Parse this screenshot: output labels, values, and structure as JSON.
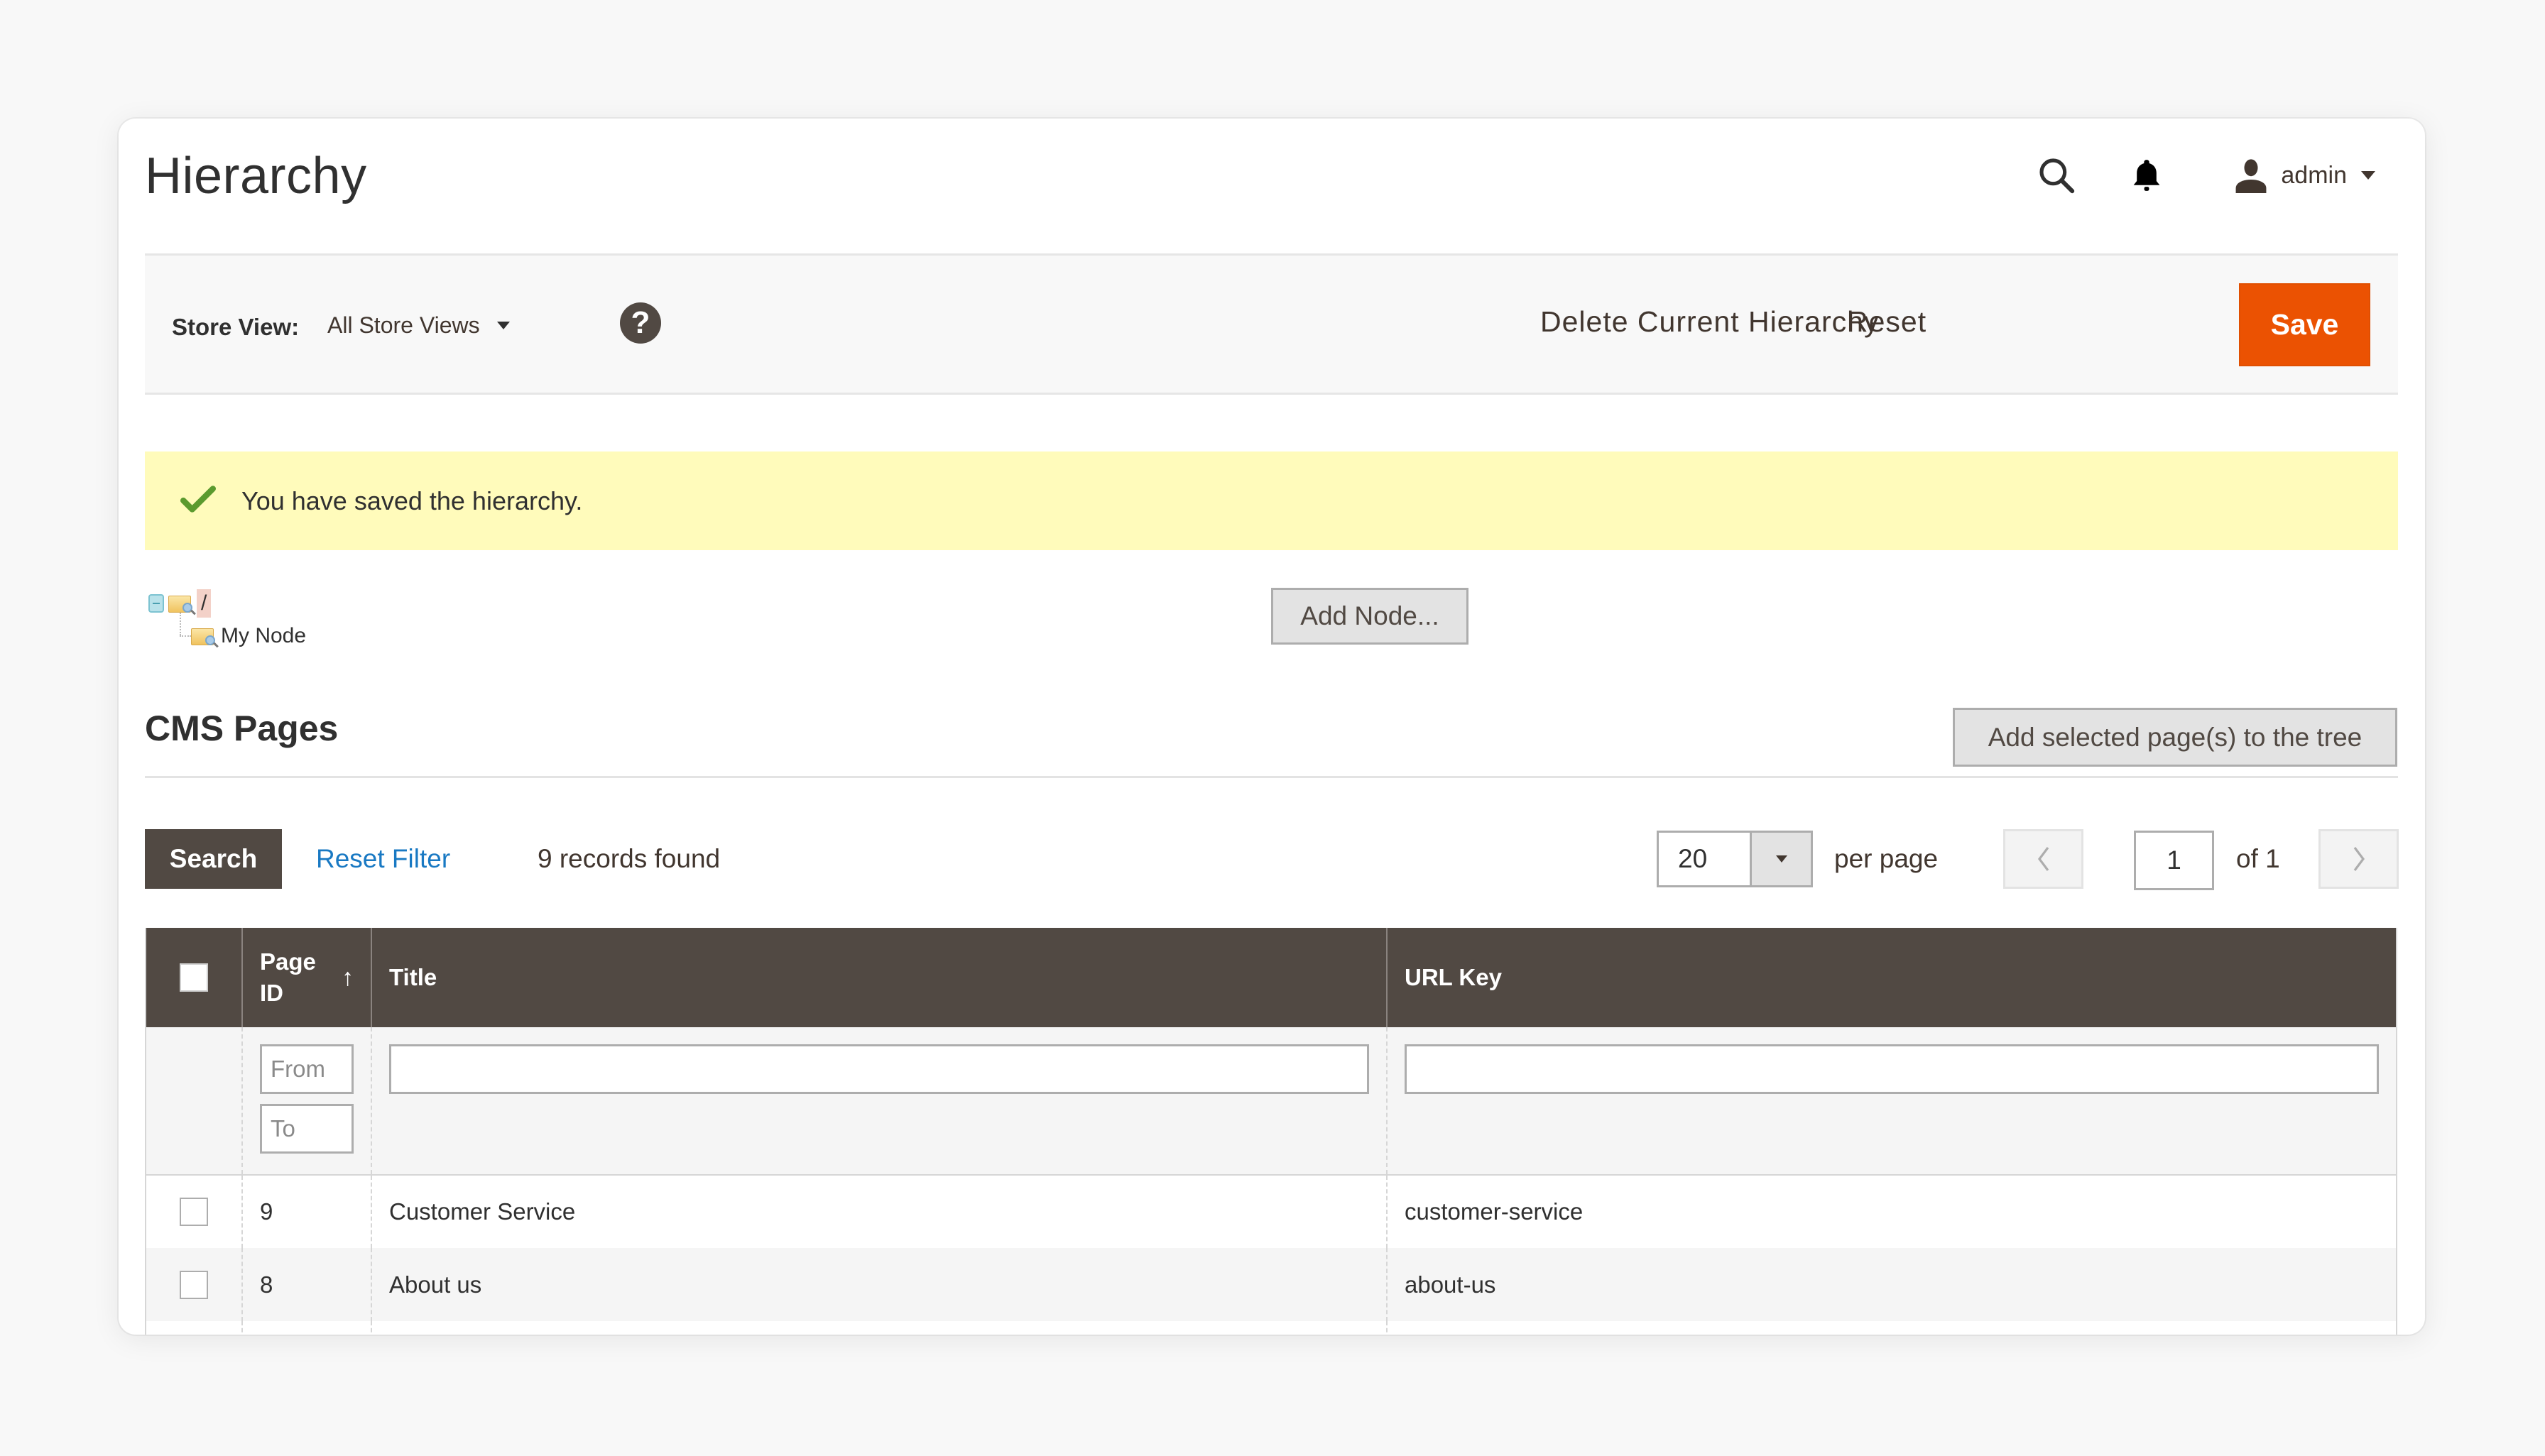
{
  "page": {
    "title": "Hierarchy"
  },
  "header": {
    "search_icon": "search-icon",
    "notifications_icon": "bell-icon",
    "user_icon": "user-icon",
    "user_name": "admin"
  },
  "toolbar": {
    "store_view_label": "Store View:",
    "store_view_value": "All Store Views",
    "help_glyph": "?",
    "delete_label": "Delete Current Hierarchy",
    "reset_label": "Reset",
    "save_label": "Save",
    "save_color": "#eb5202"
  },
  "message": {
    "text": "You have saved the hierarchy.",
    "type": "success",
    "bg_color": "#fffbbb"
  },
  "tree": {
    "root_label": "/",
    "children": [
      {
        "label": "My Node"
      }
    ],
    "add_node_label": "Add Node..."
  },
  "cms_pages": {
    "title": "CMS Pages",
    "add_selected_label": "Add selected page(s) to the tree",
    "search_label": "Search",
    "reset_filter_label": "Reset Filter",
    "records_found": "9 records found",
    "per_page_value": "20",
    "per_page_label": "per page",
    "current_page": "1",
    "page_of": "of 1",
    "columns": [
      {
        "label": ""
      },
      {
        "label": "Page ID",
        "sort": "ascending",
        "sort_glyph": "↑"
      },
      {
        "label": "Title"
      },
      {
        "label": "URL Key"
      }
    ],
    "filters": {
      "page_id_from_placeholder": "From",
      "page_id_to_placeholder": "To",
      "title_value": "",
      "url_key_value": ""
    },
    "rows": [
      {
        "page_id": "9",
        "title": "Customer Service",
        "url_key": "customer-service"
      },
      {
        "page_id": "8",
        "title": "About us",
        "url_key": "about-us"
      }
    ],
    "header_color": "#514943",
    "link_color": "#1979c3"
  }
}
